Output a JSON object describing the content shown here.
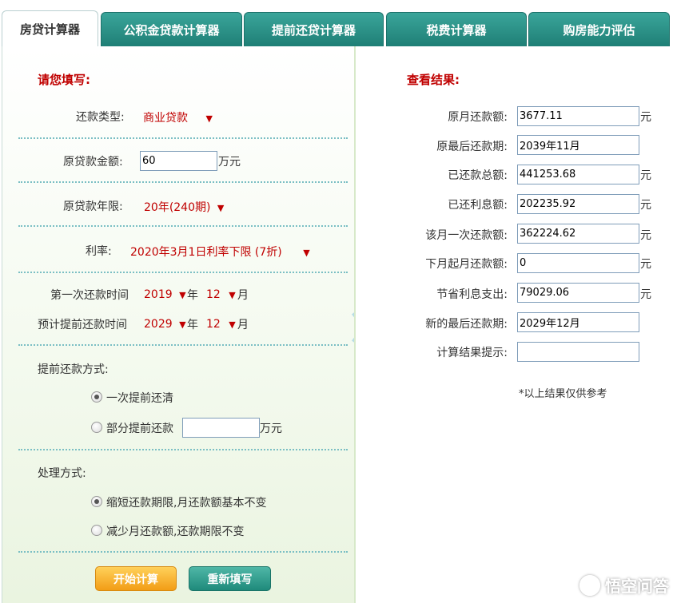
{
  "tabs": [
    {
      "label": "房贷计算器",
      "active": true
    },
    {
      "label": "公积金贷款计算器",
      "active": false
    },
    {
      "label": "提前还贷计算器",
      "active": false
    },
    {
      "label": "税费计算器",
      "active": false
    },
    {
      "label": "购房能力评估",
      "active": false
    }
  ],
  "form": {
    "title": "请您填写:",
    "repay_type_label": "还款类型:",
    "repay_type_value": "商业贷款",
    "amount_label": "原贷款金额:",
    "amount_value": "60",
    "amount_unit": "万元",
    "term_label": "原贷款年限:",
    "term_value": "20年(240期)",
    "rate_label": "利率:",
    "rate_value": "2020年3月1日利率下限 (7折)",
    "first_repay_label": "第一次还款时间",
    "first_year": "2019",
    "first_month": "12",
    "prepay_time_label": "预计提前还款时间",
    "prepay_year": "2029",
    "prepay_month": "12",
    "year_unit": "年",
    "month_unit": "月",
    "prepay_method_label": "提前还款方式:",
    "prepay_option_full": "一次提前还清",
    "prepay_option_partial": "部分提前还款",
    "partial_value": "",
    "partial_unit": "万元",
    "process_label": "处理方式:",
    "process_option_shorten": "缩短还款期限,月还款额基本不变",
    "process_option_reduce": "减少月还款额,还款期限不变",
    "start_button": "开始计算",
    "reset_button": "重新填写"
  },
  "results": {
    "title": "查看结果:",
    "rows": [
      {
        "label": "原月还款额:",
        "value": "3677.11",
        "unit": "元"
      },
      {
        "label": "原最后还款期:",
        "value": "2039年11月",
        "unit": ""
      },
      {
        "label": "已还款总额:",
        "value": "441253.68",
        "unit": "元"
      },
      {
        "label": "已还利息额:",
        "value": "202235.92",
        "unit": "元"
      },
      {
        "label": "该月一次还款额:",
        "value": "362224.62",
        "unit": "元"
      },
      {
        "label": "下月起月还款额:",
        "value": "0",
        "unit": "元"
      },
      {
        "label": "节省利息支出:",
        "value": "79029.06",
        "unit": "元"
      },
      {
        "label": "新的最后还款期:",
        "value": "2029年12月",
        "unit": ""
      },
      {
        "label": "计算结果提示:",
        "value": "",
        "unit": ""
      }
    ],
    "note": "*以上结果仅供参考"
  },
  "watermark": "悟空问答",
  "colors": {
    "accent_red": "#c00000",
    "tab_teal": "#2a9086",
    "button_orange": "#f29d16",
    "button_green": "#1f8a7b"
  }
}
